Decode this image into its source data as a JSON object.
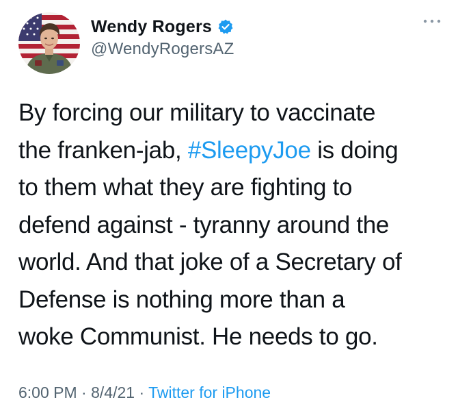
{
  "author": {
    "display_name": "Wendy Rogers",
    "handle": "@WendyRogersAZ",
    "verified": true,
    "avatar_icon": "profile-photo-flag-background"
  },
  "icons": {
    "verified": "verified-badge-icon",
    "more": "more-options-icon"
  },
  "tweet": {
    "lines": [
      {
        "before": "By forcing our military to vaccinate"
      },
      {
        "before": "the franken-jab, ",
        "hashtag": "#SleepyJoe",
        "after": " is doing"
      },
      {
        "before": "to them what they are fighting to"
      },
      {
        "before": "defend against - tyranny around the"
      },
      {
        "before": "world. And that joke of a Secretary of"
      },
      {
        "before": "Defense is nothing more than a"
      },
      {
        "before": "woke Communist. He needs to go."
      }
    ]
  },
  "meta": {
    "time": "6:00 PM",
    "separator1": " · ",
    "date": "8/4/21",
    "separator2": " · ",
    "source": "Twitter for iPhone"
  },
  "colors": {
    "text": "#0f1419",
    "secondary": "#536471",
    "link": "#1d9bf0"
  }
}
